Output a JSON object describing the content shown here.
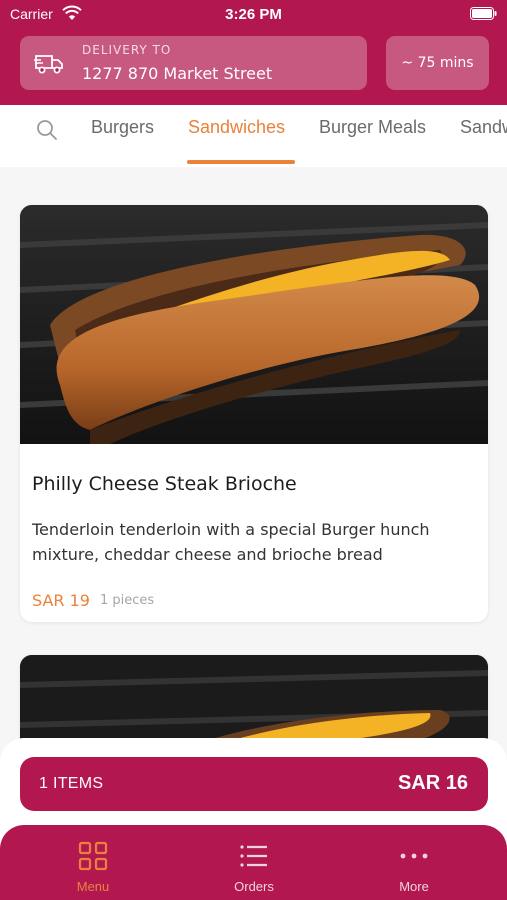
{
  "status_bar": {
    "carrier": "Carrier",
    "time": "3:26 PM"
  },
  "delivery": {
    "label": "DELIVERY TO",
    "address": "1277 870 Market Street",
    "eta": "~ 75 mins"
  },
  "categories": {
    "active": "Sandwiches",
    "items": [
      "Burgers",
      "Sandwiches",
      "Burger Meals",
      "Sandw"
    ]
  },
  "products": [
    {
      "title": "Philly Cheese Steak Brioche",
      "description": "Tenderloin tenderloin with a special Burger hunch mixture, cheddar cheese and brioche bread",
      "price": "SAR 19",
      "pieces": "1 pieces"
    }
  ],
  "cart": {
    "items_label": "1 ITEMS",
    "total": "SAR 16"
  },
  "tabbar": {
    "items": [
      {
        "label": "Menu",
        "icon": "grid-icon",
        "active": true
      },
      {
        "label": "Orders",
        "icon": "list-icon",
        "active": false
      },
      {
        "label": "More",
        "icon": "more-dots-icon",
        "active": false
      }
    ]
  },
  "colors": {
    "brand": "#b2184f",
    "accent": "#e9823a"
  }
}
